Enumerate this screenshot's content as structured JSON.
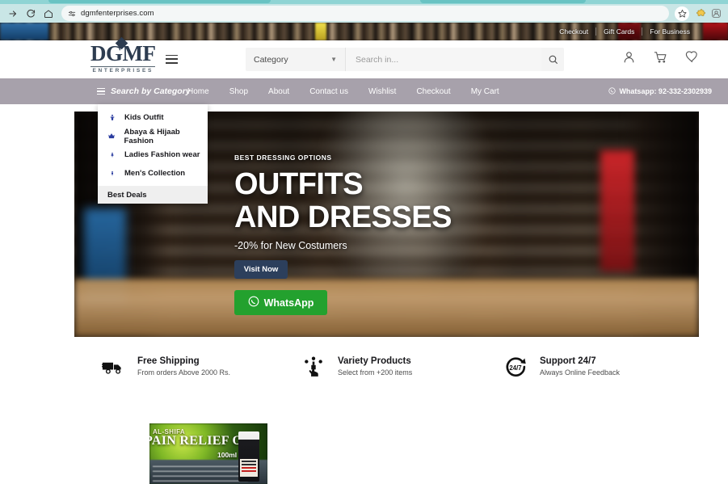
{
  "browser": {
    "url": "dgmfenterprises.com",
    "forward_icon": "forward-arrow-icon",
    "reload_icon": "reload-icon",
    "home_icon": "home-icon",
    "site_settings_icon": "site-settings-icon",
    "bookmark_icon": "star-icon",
    "extension_icon": "extension-puzzle-icon",
    "profile_icon": "profile-icon"
  },
  "top_strip": {
    "links": [
      "Checkout",
      "Gift Cards",
      "For Business"
    ]
  },
  "header": {
    "logo_main": "DGMF",
    "logo_sub": "ENTERPRISES",
    "menu_icon": "hamburger-icon",
    "category_label": "Category",
    "category_chevron": "chevron-down-icon",
    "search_placeholder": "Search in...",
    "search_value": "",
    "search_icon": "search-icon",
    "account_icon": "user-icon",
    "cart_icon": "cart-icon",
    "wishlist_icon": "heart-icon"
  },
  "nav": {
    "category_button": "Search by Category",
    "category_icon": "hamburger-icon",
    "links": [
      "Home",
      "Shop",
      "About",
      "Contact us",
      "Wishlist",
      "Checkout",
      "My Cart"
    ],
    "whatsapp_icon": "whatsapp-icon",
    "whatsapp_label": "Whatsapp: 92-332-2302939",
    "background_color": "#a7a1ab"
  },
  "category_dropdown": {
    "items": [
      {
        "label": "Kids Outfit",
        "icon": "kids-icon"
      },
      {
        "label": "Abaya & Hijaab Fashion",
        "icon": "crown-icon"
      },
      {
        "label": "Ladies Fashion wear",
        "icon": "woman-icon"
      },
      {
        "label": "Men's Collection",
        "icon": "man-icon"
      }
    ],
    "footer_label": "Best Deals"
  },
  "hero": {
    "eyebrow": "BEST DRESSING OPTIONS",
    "title_line1": "OUTFITS",
    "title_line2": "AND DRESSES",
    "subtitle": "-20% for New Costumers",
    "visit_button": "Visit Now",
    "whatsapp_button": "WhatsApp",
    "whatsapp_icon": "whatsapp-icon",
    "visit_button_color": "#2c3f5c",
    "whatsapp_button_color": "#23a12e"
  },
  "features": [
    {
      "icon": "truck-icon",
      "title": "Free Shipping",
      "desc": "From orders Above 2000 Rs."
    },
    {
      "icon": "click-products-icon",
      "title": "Variety Products",
      "desc": "Select from +200 items"
    },
    {
      "icon": "24-7-support-icon",
      "title": "Support 24/7",
      "desc": "Always Online Feedback"
    }
  ],
  "product": {
    "brand": "AL-SHIFA",
    "title": "PAIN RELIEF OIL",
    "volume": "100ml"
  }
}
